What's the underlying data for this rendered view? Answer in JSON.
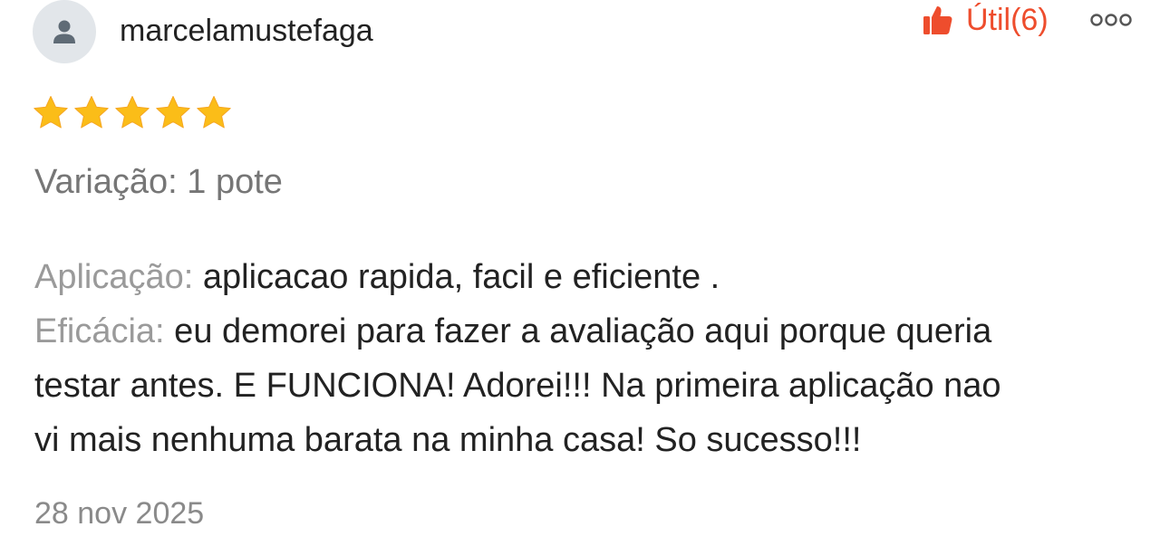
{
  "review": {
    "username": "marcelamustefaga",
    "avatar_icon": "user-silhouette-icon",
    "rating": 5,
    "rating_max": 5,
    "helpful": {
      "icon": "thumbs-up-icon",
      "label": "Útil(6)",
      "color": "#ee4d2d"
    },
    "more_icon": "more-options-icon",
    "variation": "Variação: 1 pote",
    "aplicacao_label": "Aplicação:",
    "aplicacao_text": " aplicacao rapida, facil e eficiente .",
    "eficacia_label": "Eficácia:",
    "eficacia_text_1": " eu demorei para fazer a avaliação aqui porque queria",
    "eficacia_text_2": "testar antes. E FUNCIONA! Adorei!!! Na primeira aplicação nao",
    "eficacia_text_3": "vi mais nenhuma barata na minha casa! So sucesso!!!",
    "date": "28 nov 2025",
    "star_color": "#fbbd18"
  }
}
